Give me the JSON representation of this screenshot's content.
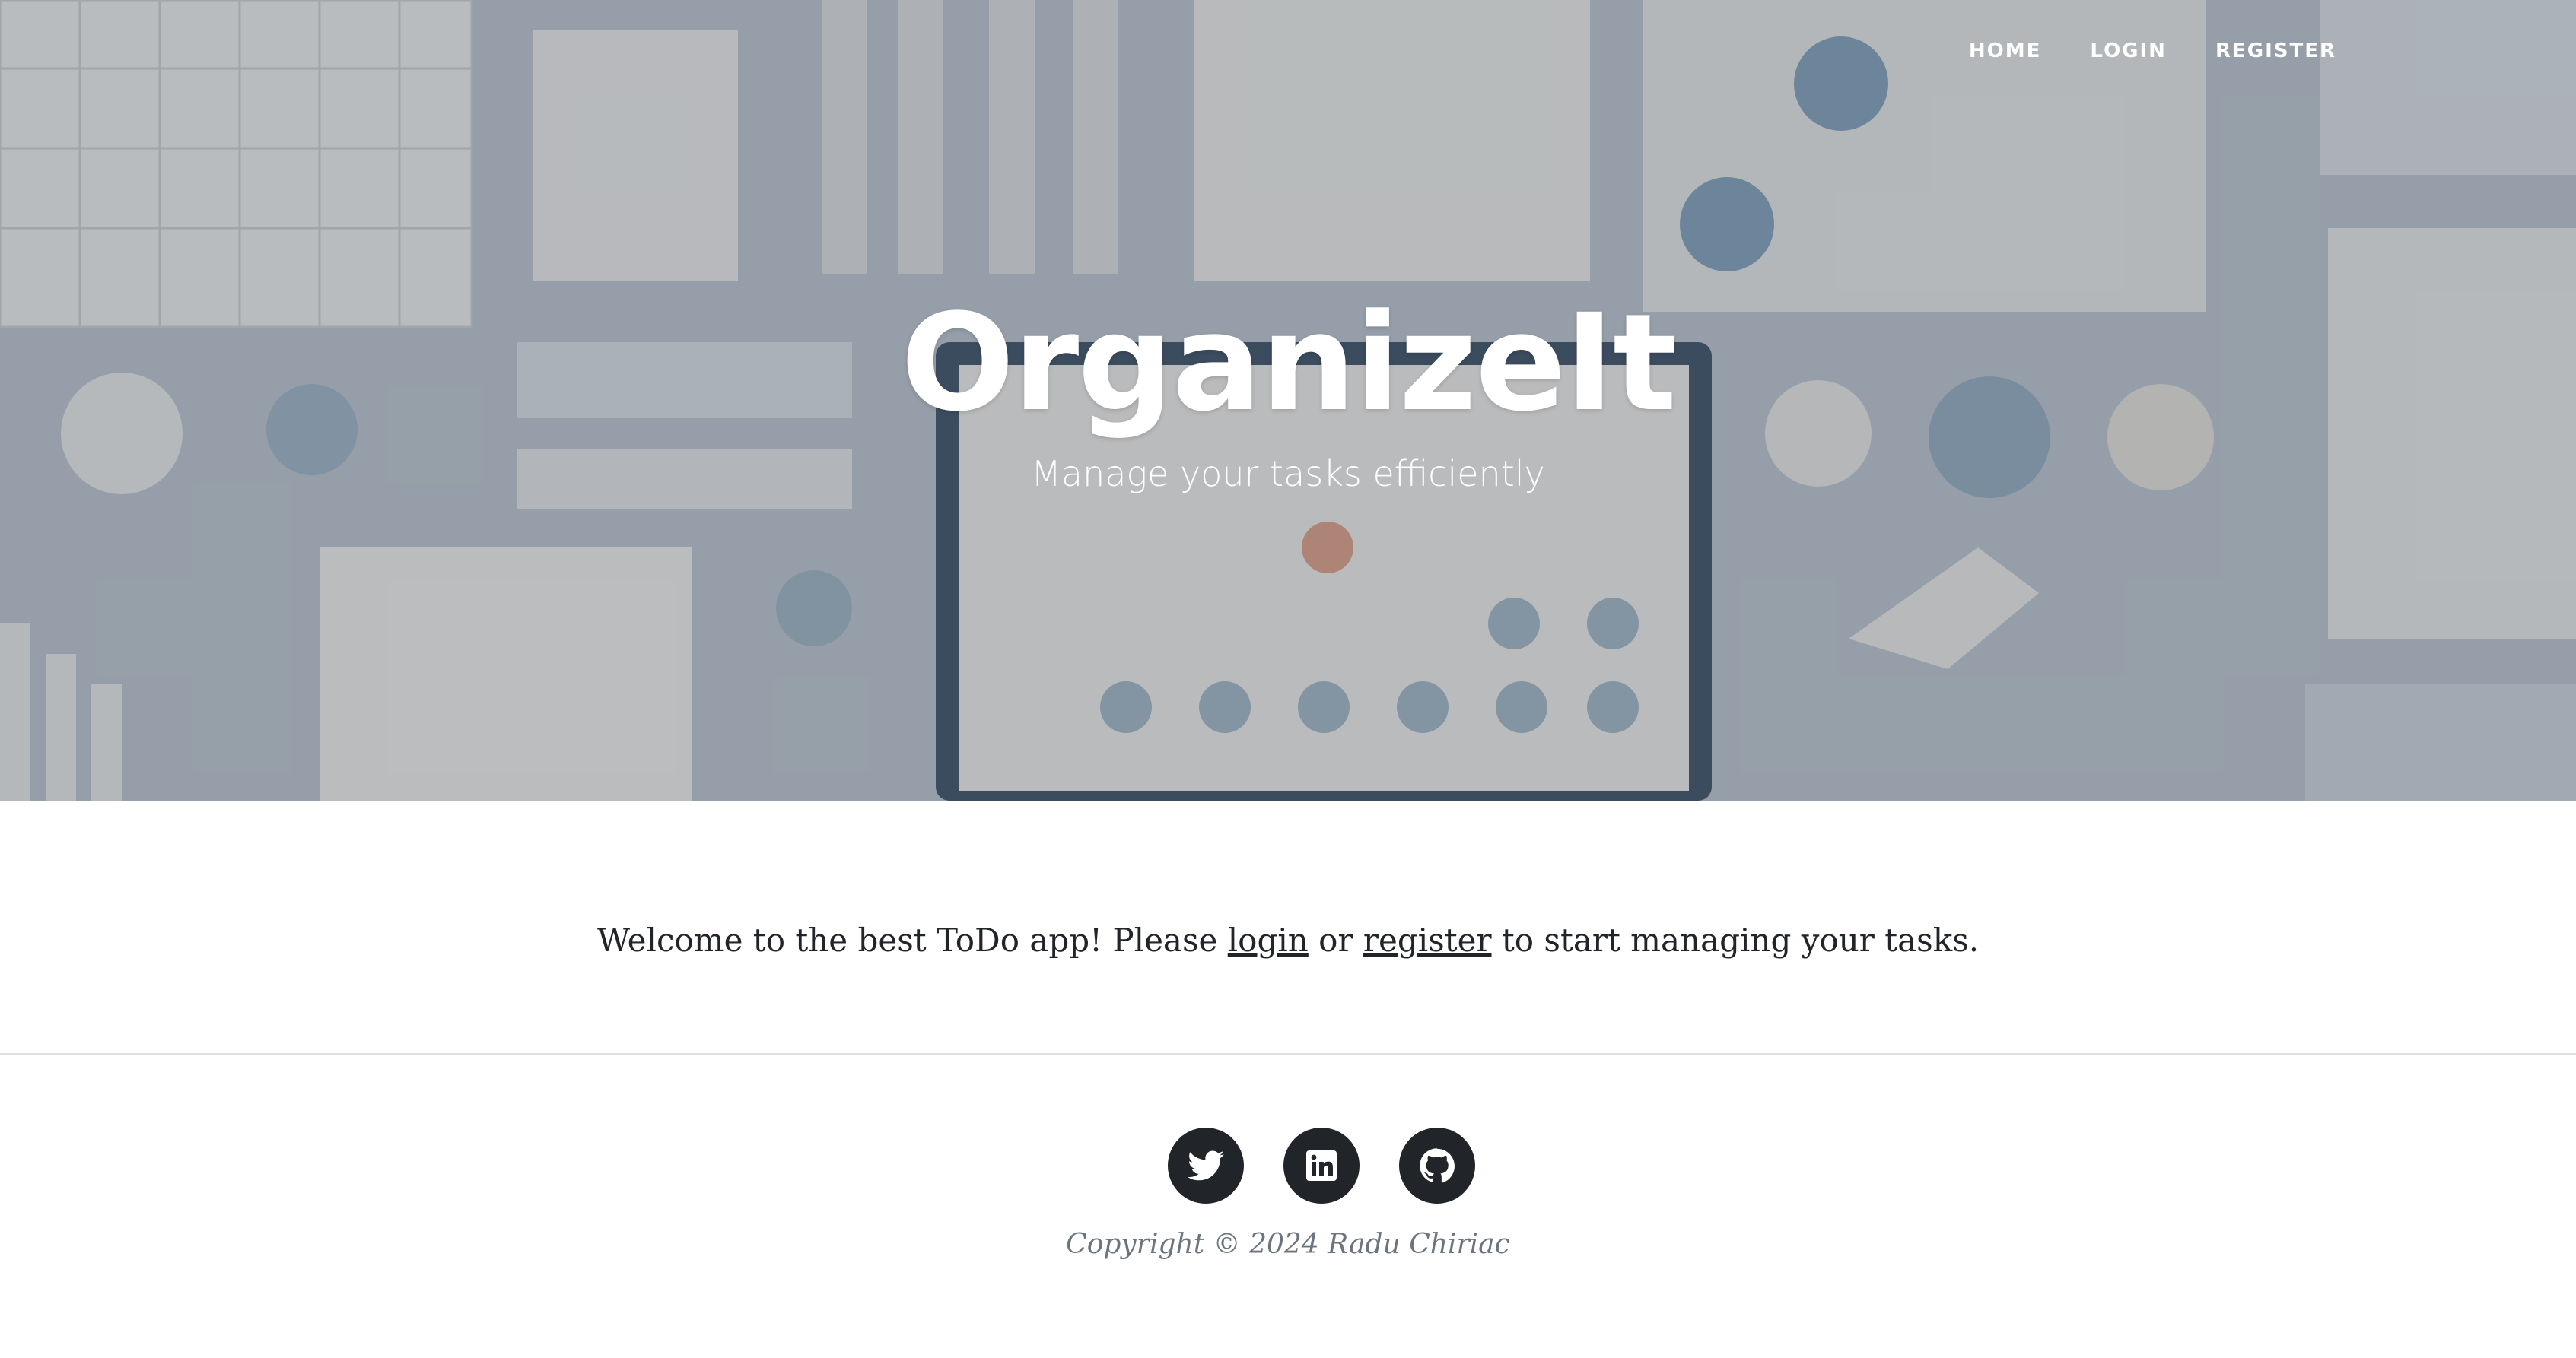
{
  "nav": {
    "home": "HOME",
    "login": "LOGIN",
    "register": "REGISTER"
  },
  "hero": {
    "title": "OrganizeIt",
    "subtitle": "Manage your tasks efficiently"
  },
  "welcome": {
    "pre": "Welcome to the best ToDo app! Please ",
    "login_link": "login",
    "mid": " or ",
    "register_link": "register",
    "post": " to start managing your tasks."
  },
  "footer": {
    "social": [
      "twitter-icon",
      "linkedin-icon",
      "github-icon"
    ],
    "copyright": "Copyright © 2024 Radu Chiriac"
  },
  "colors": {
    "hero_overlay": "#a9b4be",
    "dark": "#212529",
    "muted": "#6c757d",
    "divider": "#dee2e6"
  }
}
